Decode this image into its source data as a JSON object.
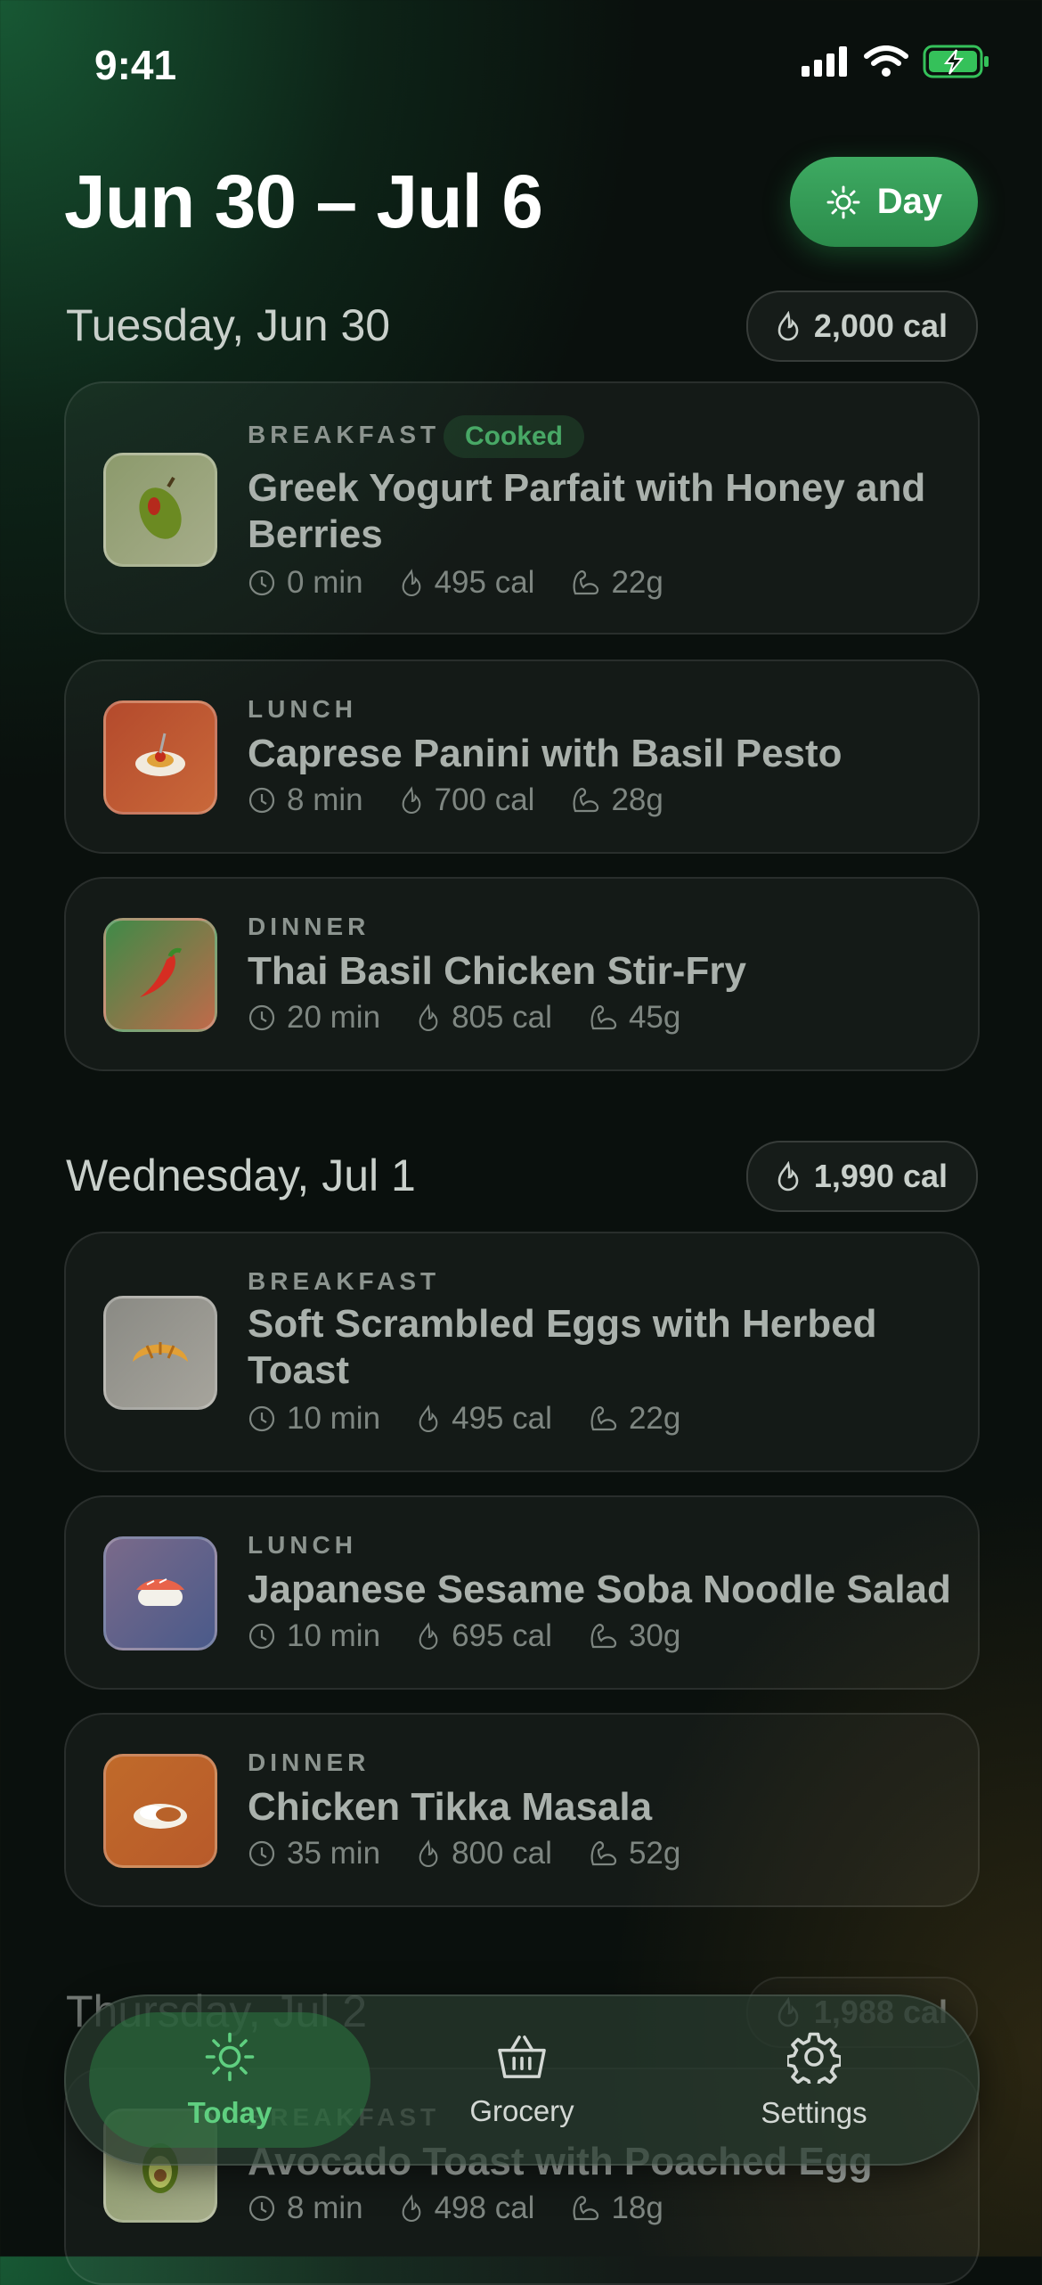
{
  "status_bar": {
    "time": "9:41"
  },
  "header": {
    "title": "Jun 30 – Jul 6",
    "toggle_label": "Day"
  },
  "days": [
    {
      "title": "Tuesday, Jun 30",
      "calories": "2,000 cal",
      "meals": [
        {
          "type": "BREAKFAST",
          "badge": "Cooked",
          "name_line1": "Greek Yogurt Parfait with Honey and",
          "name_line2": "Berries",
          "time": "0 min",
          "cal": "495 cal",
          "protein": "22g",
          "icon": "olive-icon"
        },
        {
          "type": "LUNCH",
          "name_line1": "Caprese Panini with Basil Pesto",
          "time": "8 min",
          "cal": "700 cal",
          "protein": "28g",
          "icon": "spaghetti-icon"
        },
        {
          "type": "DINNER",
          "name_line1": "Thai Basil Chicken Stir-Fry",
          "time": "20 min",
          "cal": "805 cal",
          "protein": "45g",
          "icon": "chili-pepper-icon"
        }
      ]
    },
    {
      "title": "Wednesday, Jul 1",
      "calories": "1,990 cal",
      "meals": [
        {
          "type": "BREAKFAST",
          "name_line1": "Soft Scrambled Eggs with Herbed",
          "name_line2": "Toast",
          "time": "10 min",
          "cal": "495 cal",
          "protein": "22g",
          "icon": "croissant-icon"
        },
        {
          "type": "LUNCH",
          "name_line1": "Japanese Sesame Soba Noodle Salad",
          "time": "10 min",
          "cal": "695 cal",
          "protein": "30g",
          "icon": "sushi-icon"
        },
        {
          "type": "DINNER",
          "name_line1": "Chicken Tikka Masala",
          "time": "35 min",
          "cal": "800 cal",
          "protein": "52g",
          "icon": "curry-rice-icon"
        }
      ]
    },
    {
      "title": "Thursday, Jul 2",
      "calories": "1,988 cal",
      "meals": [
        {
          "type": "BREAKFAST",
          "name_line1": "Avocado Toast with Poached Egg",
          "time": "8 min",
          "cal": "498 cal",
          "protein": "18g",
          "icon": "avocado-icon"
        }
      ]
    }
  ],
  "tabbar": [
    {
      "label": "Today",
      "icon": "sun-icon",
      "active": true
    },
    {
      "label": "Grocery",
      "icon": "basket-icon",
      "active": false
    },
    {
      "label": "Settings",
      "icon": "gear-icon",
      "active": false
    }
  ],
  "colors": {
    "accent": "#3eaa62",
    "background": "#0a100d",
    "cooked": "#48a866"
  }
}
